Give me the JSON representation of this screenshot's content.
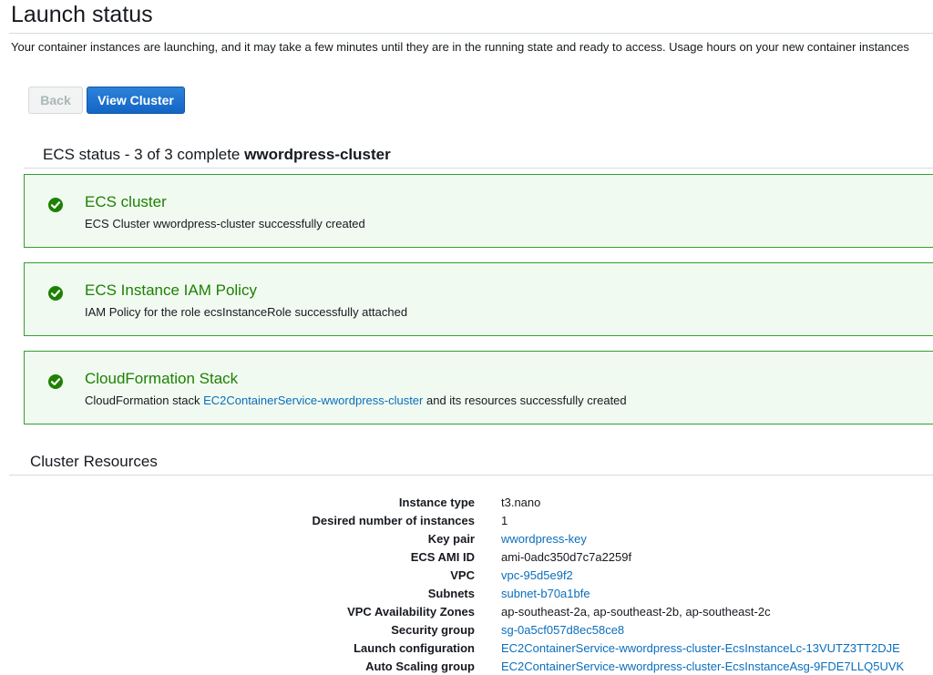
{
  "page": {
    "title": "Launch status",
    "intro": "Your container instances are launching, and it may take a few minutes until they are in the running state and ready to access. Usage hours on your new container instances"
  },
  "buttons": {
    "back": "Back",
    "view_cluster": "View Cluster"
  },
  "ecs_status": {
    "label": "ECS status - 3 of 3 complete",
    "cluster_name": "wwordpress-cluster"
  },
  "cards": [
    {
      "title": "ECS cluster",
      "desc": "ECS Cluster wwordpress-cluster successfully created"
    },
    {
      "title": "ECS Instance IAM Policy",
      "desc": "IAM Policy for the role ecsInstanceRole successfully attached"
    },
    {
      "title": "CloudFormation Stack",
      "desc_prefix": "CloudFormation stack ",
      "desc_link": "EC2ContainerService-wwordpress-cluster",
      "desc_suffix": " and its resources successfully created"
    }
  ],
  "cluster_resources": {
    "title": "Cluster Resources",
    "rows": [
      {
        "label": "Instance type",
        "value": "t3.nano"
      },
      {
        "label": "Desired number of instances",
        "value": "1"
      },
      {
        "label": "Key pair",
        "value": "wwordpress-key"
      },
      {
        "label": "ECS AMI ID",
        "value": "ami-0adc350d7c7a2259f"
      },
      {
        "label": "VPC",
        "value": "vpc-95d5e9f2"
      },
      {
        "label": "Subnets",
        "value": "subnet-b70a1bfe"
      },
      {
        "label": "VPC Availability Zones",
        "value": "ap-southeast-2a, ap-southeast-2b, ap-southeast-2c"
      },
      {
        "label": "Security group",
        "value": "sg-0a5cf057d8ec58ce8"
      },
      {
        "label": "Launch configuration",
        "value": "EC2ContainerService-wwordpress-cluster-EcsInstanceLc-13VUTZ3TT2DJE"
      },
      {
        "label": "Auto Scaling group",
        "value": "EC2ContainerService-wwordpress-cluster-EcsInstanceAsg-9FDE7LLQ5UVK"
      }
    ]
  },
  "colors": {
    "success_green": "#1d8102",
    "success_border": "#2fa12f",
    "success_bg": "#f1faf1",
    "link_blue": "#0a6ebd",
    "primary_button": "#1466c6"
  },
  "icons": {
    "status_check": "check-circle-icon"
  }
}
